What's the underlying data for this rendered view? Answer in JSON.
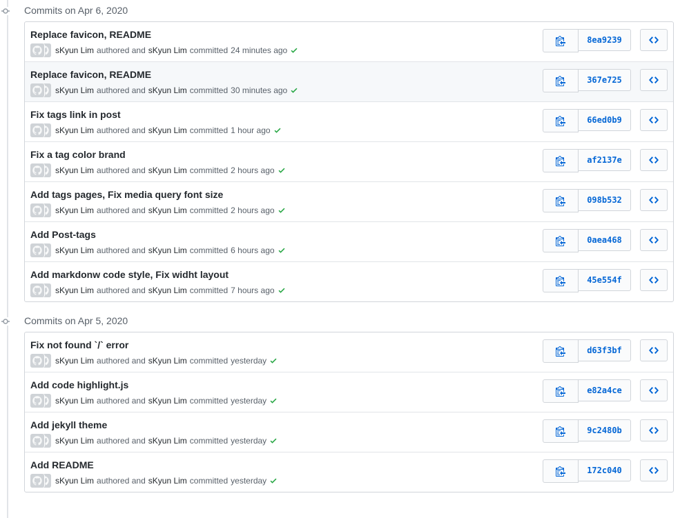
{
  "groups": [
    {
      "header": "Commits on Apr 6, 2020",
      "commits": [
        {
          "title": "Replace favicon, README",
          "author": "sKyun Lim",
          "authored_text": "authored and",
          "committer": "sKyun Lim",
          "committed_text": "committed",
          "time": "24 minutes ago",
          "sha": "8ea9239"
        },
        {
          "title": "Replace favicon, README",
          "author": "sKyun Lim",
          "authored_text": "authored and",
          "committer": "sKyun Lim",
          "committed_text": "committed",
          "time": "30 minutes ago",
          "sha": "367e725"
        },
        {
          "title": "Fix tags link in post",
          "author": "sKyun Lim",
          "authored_text": "authored and",
          "committer": "sKyun Lim",
          "committed_text": "committed",
          "time": "1 hour ago",
          "sha": "66ed0b9"
        },
        {
          "title": "Fix a tag color brand",
          "author": "sKyun Lim",
          "authored_text": "authored and",
          "committer": "sKyun Lim",
          "committed_text": "committed",
          "time": "2 hours ago",
          "sha": "af2137e"
        },
        {
          "title": "Add tags pages, Fix media query font size",
          "author": "sKyun Lim",
          "authored_text": "authored and",
          "committer": "sKyun Lim",
          "committed_text": "committed",
          "time": "2 hours ago",
          "sha": "098b532"
        },
        {
          "title": "Add Post-tags",
          "author": "sKyun Lim",
          "authored_text": "authored and",
          "committer": "sKyun Lim",
          "committed_text": "committed",
          "time": "6 hours ago",
          "sha": "0aea468"
        },
        {
          "title": "Add markdonw code style, Fix widht layout",
          "author": "sKyun Lim",
          "authored_text": "authored and",
          "committer": "sKyun Lim",
          "committed_text": "committed",
          "time": "7 hours ago",
          "sha": "45e554f"
        }
      ]
    },
    {
      "header": "Commits on Apr 5, 2020",
      "commits": [
        {
          "title": "Fix not found `/` error",
          "author": "sKyun Lim",
          "authored_text": "authored and",
          "committer": "sKyun Lim",
          "committed_text": "committed",
          "time": "yesterday",
          "sha": "d63f3bf"
        },
        {
          "title": "Add code highlight.js",
          "author": "sKyun Lim",
          "authored_text": "authored and",
          "committer": "sKyun Lim",
          "committed_text": "committed",
          "time": "yesterday",
          "sha": "e82a4ce"
        },
        {
          "title": "Add jekyll theme",
          "author": "sKyun Lim",
          "authored_text": "authored and",
          "committer": "sKyun Lim",
          "committed_text": "committed",
          "time": "yesterday",
          "sha": "9c2480b"
        },
        {
          "title": "Add README",
          "author": "sKyun Lim",
          "authored_text": "authored and",
          "committer": "sKyun Lim",
          "committed_text": "committed",
          "time": "yesterday",
          "sha": "172c040"
        }
      ]
    }
  ],
  "highlighted_row": {
    "group": 0,
    "commit": 1
  },
  "icons": {
    "commit_node": "git-commit-icon",
    "copy": "clippy-icon",
    "browse": "code-icon",
    "status": "check-icon",
    "avatar": "github-avatar-placeholder"
  },
  "colors": {
    "sha_link": "#0366d6",
    "check_green": "#28a745",
    "border": "#d1d5da",
    "hover_row": "#f6f8fa",
    "muted_text": "#586069",
    "icon_blue": "#0366d6"
  }
}
